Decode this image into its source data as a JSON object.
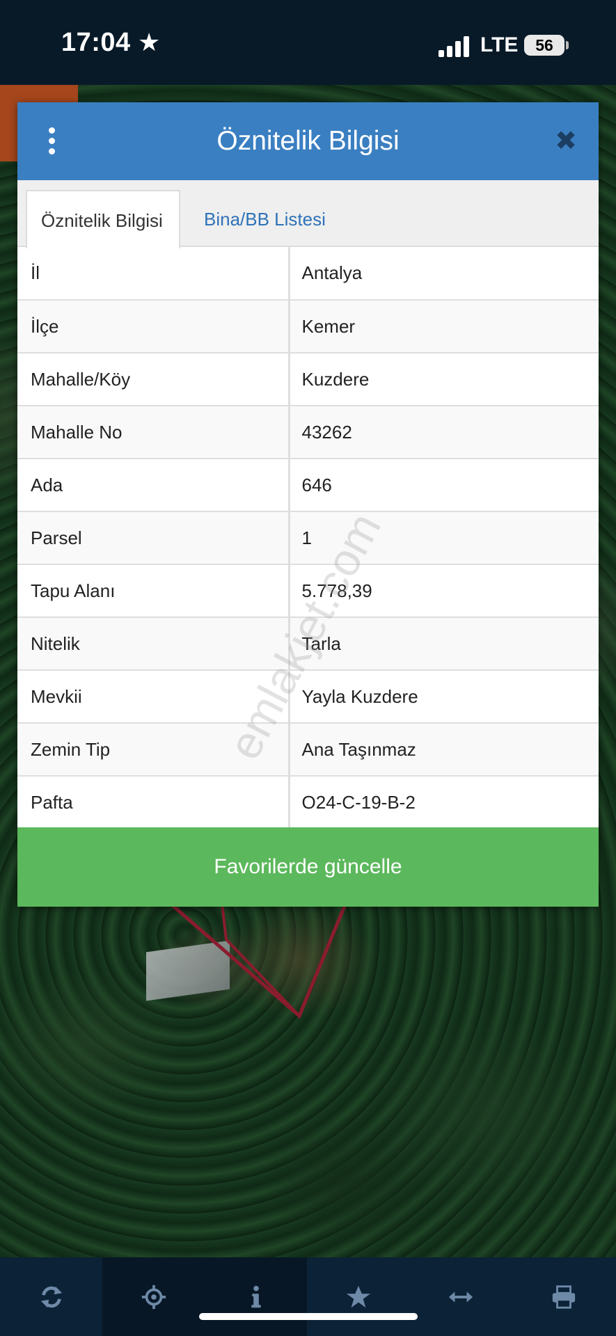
{
  "status_bar": {
    "time": "17:04",
    "network": "LTE",
    "battery": "56"
  },
  "modal": {
    "title": "Öznitelik Bilgisi",
    "tabs": [
      {
        "label": "Öznitelik Bilgisi",
        "active": true
      },
      {
        "label": "Bina/BB Listesi",
        "active": false
      }
    ],
    "rows": [
      {
        "key": "İl",
        "value": "Antalya"
      },
      {
        "key": "İlçe",
        "value": "Kemer"
      },
      {
        "key": "Mahalle/Köy",
        "value": "Kuzdere"
      },
      {
        "key": "Mahalle No",
        "value": "43262"
      },
      {
        "key": "Ada",
        "value": "646"
      },
      {
        "key": "Parsel",
        "value": "1"
      },
      {
        "key": "Tapu Alanı",
        "value": "5.778,39"
      },
      {
        "key": "Nitelik",
        "value": "Tarla"
      },
      {
        "key": "Mevkii",
        "value": "Yayla Kuzdere"
      },
      {
        "key": "Zemin Tip",
        "value": "Ana Taşınmaz"
      },
      {
        "key": "Pafta",
        "value": "O24-C-19-B-2"
      }
    ],
    "favorite_button": "Favorilerde güncelle"
  },
  "watermark": "emlakjet.com",
  "toolbar": {
    "items": [
      "refresh-icon",
      "locate-icon",
      "info-icon",
      "star-icon",
      "measure-icon",
      "print-icon"
    ],
    "active": "info-icon",
    "icon_color": "#6e8aa8"
  },
  "colors": {
    "header": "#3a7fc1",
    "button": "#5cb85c",
    "tab_link": "#2f72b8",
    "parcel_outline": "#8a1c2e"
  }
}
